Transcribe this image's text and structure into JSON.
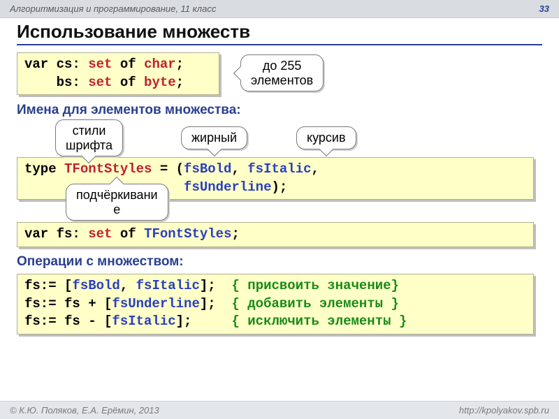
{
  "header": {
    "course": "Алгоритмизация и программирование, 11 класс",
    "page": "33"
  },
  "title": "Использование множеств",
  "code1": {
    "l1a": "var",
    "l1b": " cs: ",
    "l1c": "set",
    "l1d": " of ",
    "l1e": "char",
    "l1f": ";",
    "l2a": "    bs: ",
    "l2b": "set",
    "l2c": " of ",
    "l2d": "byte",
    "l2e": ";"
  },
  "callouts": {
    "elements": "до 255\nэлементов",
    "styles": "стили\nшрифта",
    "bold": "жирный",
    "italic": "курсив",
    "underline": "подчёркивани\nе"
  },
  "section1": "Имена для элементов множества:",
  "code2": {
    "l1a": "type",
    "l1b": " TFontStyles",
    "l1c": " = (",
    "l1d": "fsBold",
    "l1e": ", ",
    "l1f": "fsItalic",
    "l1g": ",",
    "l2a": "                    ",
    "l2b": "fsUnderline",
    "l2c": ");"
  },
  "code3": {
    "a": "var",
    "b": " fs: ",
    "c": "set",
    "d": " of ",
    "e": "TFontStyles",
    "f": ";"
  },
  "section2": "Операции с множеством:",
  "code4": {
    "r1a": "fs:= [",
    "r1b": "fsBold",
    "r1c": ", ",
    "r1d": "fsItalic",
    "r1e": "];  ",
    "r1f": "{ присвоить значение}",
    "r2a": "fs:= fs + [",
    "r2b": "fsUnderline",
    "r2c": "];  ",
    "r2d": "{ добавить элементы }",
    "r3a": "fs:= fs - [",
    "r3b": "fsItalic",
    "r3c": "];     ",
    "r3d": "{ исключить элементы }"
  },
  "footer": {
    "left": "© К.Ю. Поляков, Е.А. Ерёмин, 2013",
    "right": "http://kpolyakov.spb.ru"
  }
}
